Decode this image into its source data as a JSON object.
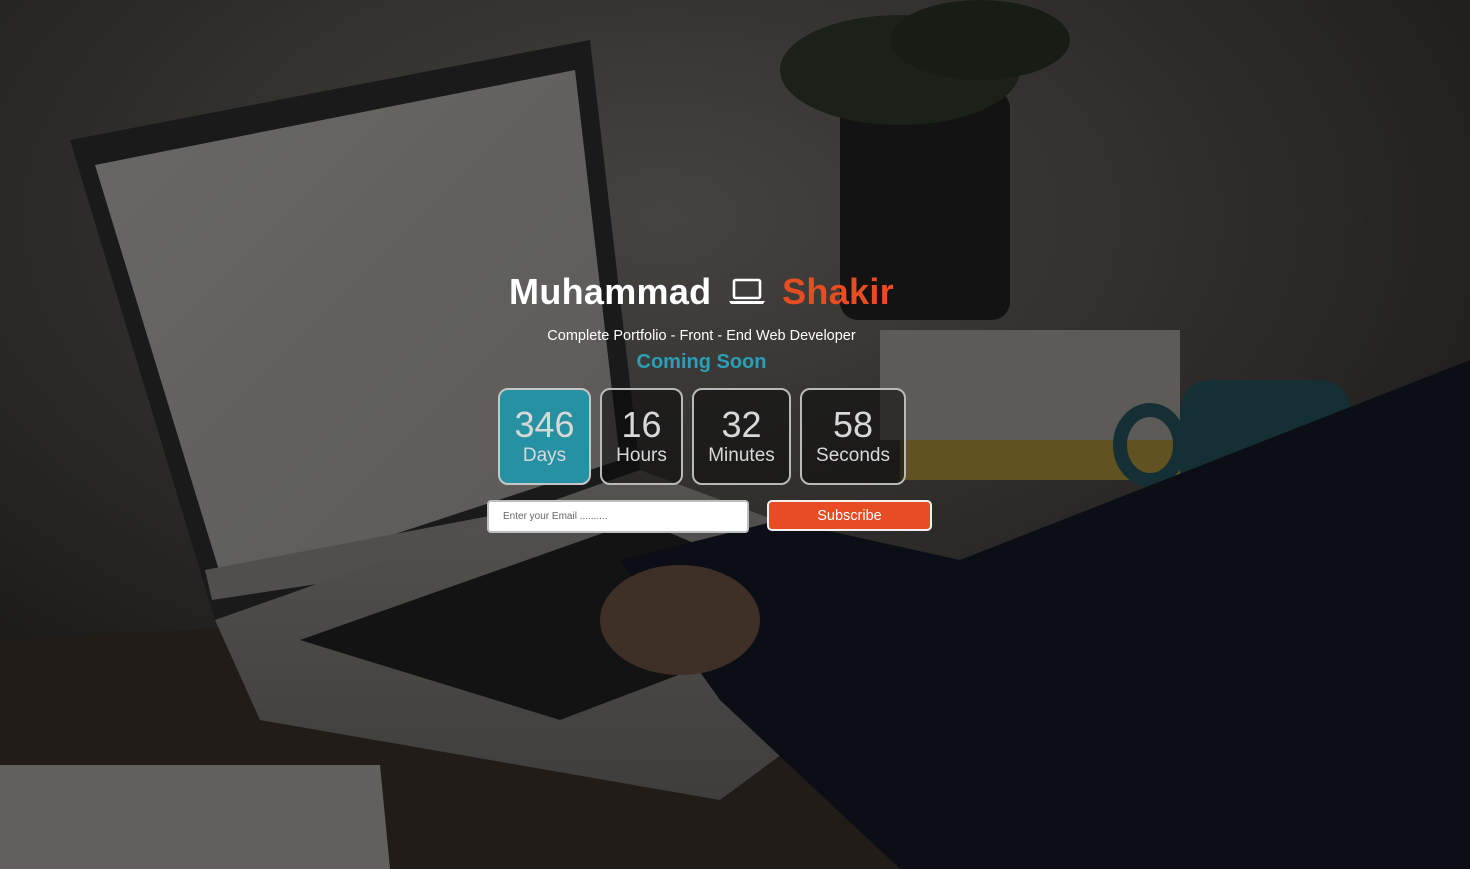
{
  "hero": {
    "first_name": "Muhammad",
    "last_name": "Shakir",
    "icon": "laptop-icon",
    "subtitle": "Complete Portfolio - Front - End Web Developer",
    "status": "Coming Soon"
  },
  "countdown": [
    {
      "value": "346",
      "unit": "Days"
    },
    {
      "value": "16",
      "unit": "Hours"
    },
    {
      "value": "32",
      "unit": "Minutes"
    },
    {
      "value": "58",
      "unit": "Seconds"
    }
  ],
  "subscribe": {
    "email_placeholder": "Enter your Email ..........",
    "email_value": "",
    "button_label": "Subscribe"
  },
  "colors": {
    "accent_orange": "#e84c22",
    "accent_teal": "#2a9fb8",
    "active_box": "#2591a3"
  }
}
